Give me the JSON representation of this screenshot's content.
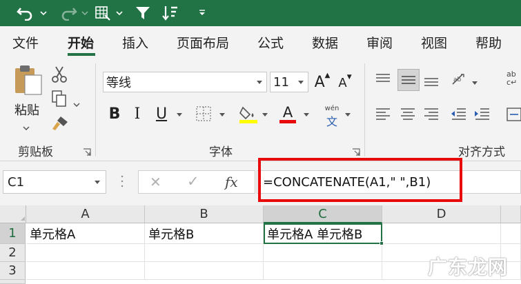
{
  "qat": {
    "undo": "undo-icon",
    "redo": "redo-icon",
    "form": "form-icon",
    "filter": "filter-icon",
    "sort": "sort-icon",
    "customize": "customize-icon"
  },
  "tabs": [
    "文件",
    "开始",
    "插入",
    "页面布局",
    "公式",
    "数据",
    "审阅",
    "视图",
    "帮助"
  ],
  "active_tab": "开始",
  "ribbon": {
    "clipboard": {
      "paste_label": "粘贴",
      "group_label": "剪贴板"
    },
    "font": {
      "font_name": "等线",
      "font_size": "11",
      "group_label": "字体",
      "pinyin_top": "wén",
      "pinyin_bottom": "文",
      "bold": "B",
      "italic": "I",
      "underline": "U",
      "grow_font": "A",
      "shrink_font": "A",
      "font_color_letter": "A"
    },
    "alignment": {
      "group_label": "对齐方式"
    }
  },
  "formula_bar": {
    "name_box": "C1",
    "cancel": "✕",
    "enter": "✓",
    "fx": "fx",
    "formula": "=CONCATENATE(A1,\" \",B1)"
  },
  "columns": [
    "A",
    "B",
    "C",
    "D"
  ],
  "rows": [
    {
      "num": "1",
      "cells": [
        "单元格A",
        "单元格B",
        "单元格A 单元格B",
        ""
      ]
    },
    {
      "num": "2",
      "cells": [
        "",
        "",
        "",
        ""
      ]
    },
    {
      "num": "3",
      "cells": [
        "",
        "",
        "",
        ""
      ]
    }
  ],
  "watermark": "广东龙网",
  "colors": {
    "accent": "#217346",
    "highlight": "#e8090a",
    "font_color": "#e8090a",
    "fill_color": "#ffff00"
  }
}
